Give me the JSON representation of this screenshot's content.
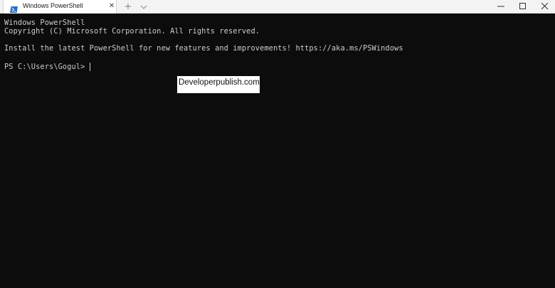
{
  "tab": {
    "title": "Windows PowerShell",
    "icon": "powershell-icon",
    "close_glyph": "✕"
  },
  "tabbar": {
    "new_tab_glyph": "+",
    "dropdown_icon": "chevron-down-icon"
  },
  "window_controls": {
    "minimize_icon": "minimize-icon",
    "maximize_icon": "maximize-icon",
    "close_icon": "close-icon"
  },
  "terminal": {
    "lines": [
      "Windows PowerShell",
      "Copyright (C) Microsoft Corporation. All rights reserved.",
      "Install the latest PowerShell for new features and improvements! https://aka.ms/PSWindows",
      "PS C:\\Users\\Gogul> "
    ]
  },
  "watermark": {
    "text": "Developerpublish.com"
  },
  "colors": {
    "terminal_bg": "#0c0c0c",
    "terminal_fg": "#cccccc",
    "titlebar_bg": "#f3f3f3",
    "tab_bg": "#ffffff",
    "powershell_blue": "#2b6cc4"
  }
}
